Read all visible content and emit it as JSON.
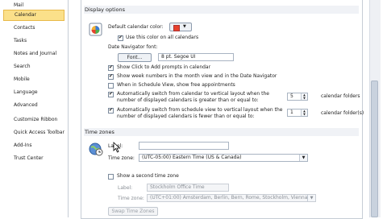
{
  "sidebar": {
    "items": [
      {
        "label": "Mail",
        "selected": false
      },
      {
        "label": "Calendar",
        "selected": true
      },
      {
        "label": "Contacts",
        "selected": false
      },
      {
        "label": "Tasks",
        "selected": false
      },
      {
        "label": "Notes and Journal",
        "selected": false
      },
      {
        "label": "Search",
        "selected": false
      },
      {
        "label": "Mobile",
        "selected": false
      },
      {
        "label": "Language",
        "selected": false
      },
      {
        "label": "Advanced",
        "selected": false
      },
      {
        "label": "Customize Ribbon",
        "selected": false
      },
      {
        "label": "Quick Access Toolbar",
        "selected": false
      },
      {
        "label": "Add-Ins",
        "selected": false
      },
      {
        "label": "Trust Center",
        "selected": false
      }
    ]
  },
  "display": {
    "header": "Display options",
    "default_color_label": "Default calendar color:",
    "use_color_all": "Use this color on all calendars",
    "date_nav_font_label": "Date Navigator font:",
    "font_button": "Font...",
    "font_value": "8 pt. Segoe UI",
    "show_click_add": "Show Click to Add prompts in calendar",
    "show_week_numbers": "Show week numbers in the month view and in the Date Navigator",
    "schedule_free": "When in Schedule View, show free appointments",
    "auto_switch_1a": "Automatically switch from calendar to vertical layout when the",
    "auto_switch_1b": "number of displayed calendars is greater than or equal to:",
    "auto_switch_1_value": "5",
    "auto_switch_1_unit": "calendar folders",
    "auto_switch_2a": "Automatically switch from schedule view to vertical layout when the",
    "auto_switch_2b": "number of displayed calendars is fewer than or equal to:",
    "auto_switch_2_value": "1",
    "auto_switch_2_unit": "calendar folder(s)",
    "accent_color": "#e8412c"
  },
  "timezones": {
    "header": "Time zones",
    "label_label": "Label:",
    "label_value": "",
    "zone_label": "Time zone:",
    "zone_value": "(UTC-05:00) Eastern Time (US & Canada)",
    "second_zone": "Show a second time zone",
    "second_label_label": "Label:",
    "second_label_value": "Stockholm Office Time",
    "second_zone_label": "Time zone:",
    "second_zone_value": "(UTC+01:00) Amsterdam, Berlin, Bern, Rome, Stockholm, Vienna",
    "swap_button": "Swap Time Zones"
  }
}
